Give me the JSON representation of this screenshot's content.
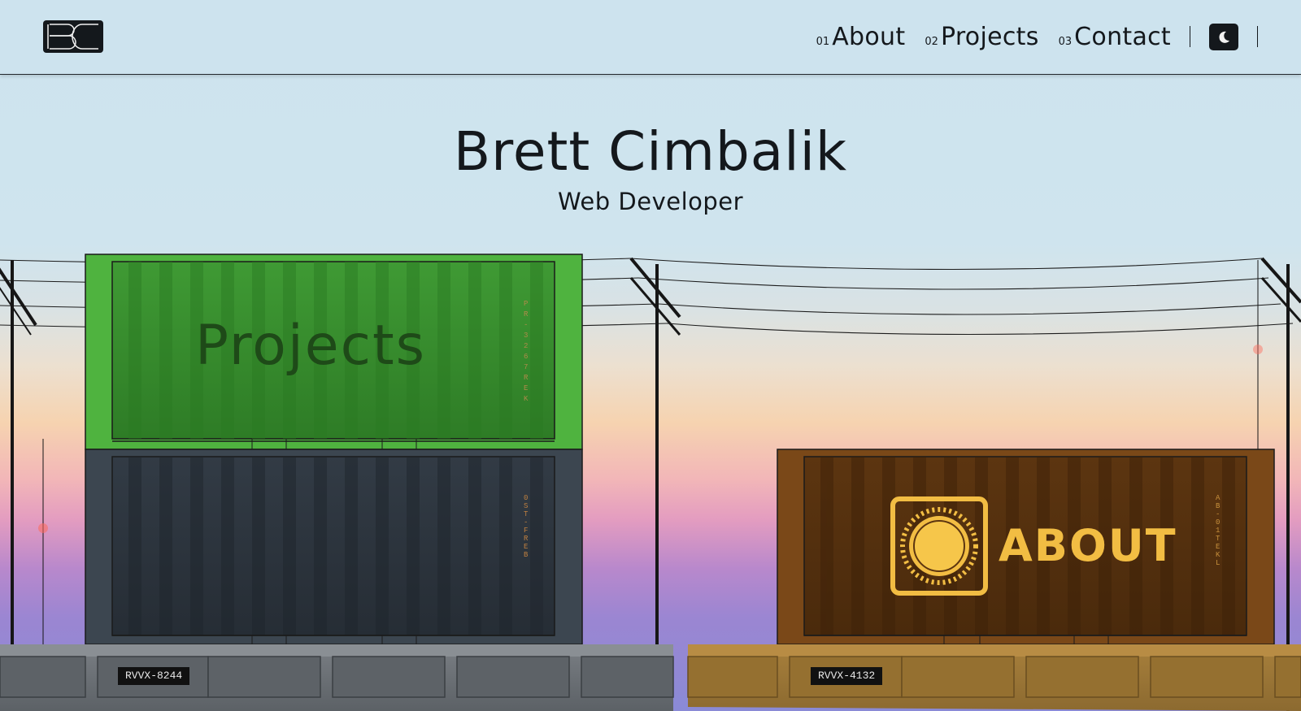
{
  "nav": {
    "logo_text": "BC",
    "links": [
      {
        "num": "01",
        "label": "About"
      },
      {
        "num": "02",
        "label": "Projects"
      },
      {
        "num": "03",
        "label": "Contact"
      }
    ],
    "theme_icon": "moon-icon"
  },
  "hero": {
    "name": "Brett Cimbalik",
    "role": "Web Developer"
  },
  "containers": {
    "projects": {
      "label": "Projects",
      "code": "PR-3267 REK",
      "color": "#4fb33f"
    },
    "dark": {
      "code": "0ST-F REB",
      "color": "#3c4650"
    },
    "about": {
      "label": "ABOUT",
      "code": "AB-01T EKL",
      "color": "#7a4818",
      "icon": "sun-icon"
    }
  },
  "railcars": [
    {
      "plate": "RVVX-8244",
      "color": "#6e7378"
    },
    {
      "plate": "RVVX-4132",
      "color": "#a27a38"
    }
  ]
}
